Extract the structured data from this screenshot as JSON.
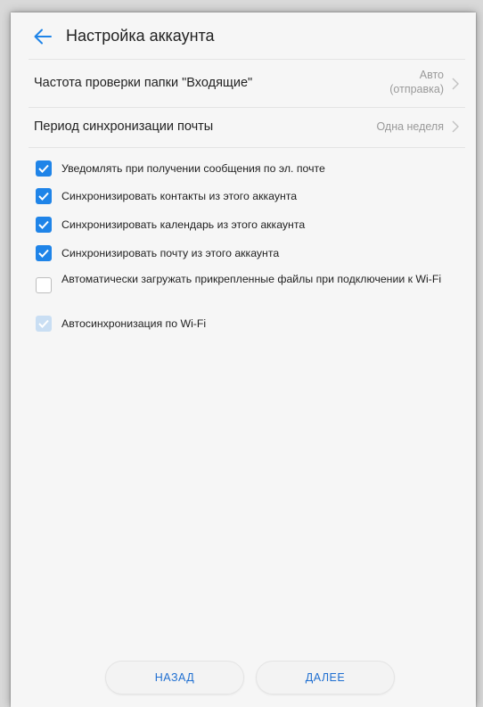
{
  "header": {
    "title": "Настройка аккаунта",
    "back_icon": "arrow-left-icon"
  },
  "settings": [
    {
      "label": "Частота проверки папки \"Входящие\"",
      "value_line1": "Авто",
      "value_line2": "(отправка)"
    },
    {
      "label": "Период синхронизации почты",
      "value_line1": "Одна неделя"
    }
  ],
  "checkboxes": [
    {
      "label": "Уведомлять при получении сообщения по эл. почте",
      "checked": true,
      "enabled": true
    },
    {
      "label": "Синхронизировать контакты из этого аккаунта",
      "checked": true,
      "enabled": true
    },
    {
      "label": "Синхронизировать календарь из этого аккаунта",
      "checked": true,
      "enabled": true
    },
    {
      "label": "Синхронизировать почту из этого аккаунта",
      "checked": true,
      "enabled": true
    },
    {
      "label": "Автоматически загружать прикрепленные файлы при подключении к Wi-Fi",
      "checked": false,
      "enabled": true
    },
    {
      "label": "Автосинхронизация по Wi-Fi",
      "checked": true,
      "enabled": false
    }
  ],
  "buttons": {
    "back_label": "НАЗАД",
    "next_label": "ДАЛЕЕ"
  },
  "colors": {
    "accent": "#1f84e8",
    "button_text": "#1f6fd1",
    "muted": "#9a9a9a"
  }
}
